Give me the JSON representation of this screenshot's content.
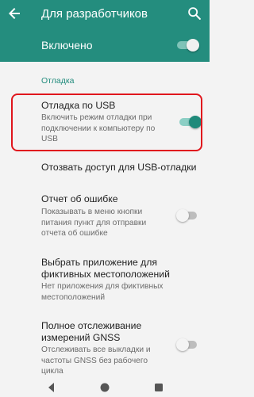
{
  "appbar": {
    "title": "Для разработчиков",
    "back_icon": "arrow-back-icon",
    "search_icon": "search-icon"
  },
  "master": {
    "label": "Включено",
    "enabled": true
  },
  "section": {
    "header": "Отладка"
  },
  "items": [
    {
      "title": "Отладка по USB",
      "summary": "Включить режим отладки при подключении к компьютеру по USB",
      "toggle": "on"
    },
    {
      "title": "Отозвать доступ для USB-отладки"
    },
    {
      "title": "Отчет об ошибке",
      "summary": "Показывать в меню кнопки питания пункт для отправки отчета об ошибке",
      "toggle": "off"
    },
    {
      "title": "Выбрать приложение для фиктивных местоположений",
      "summary": "Нет приложения для фиктивных местоположений"
    },
    {
      "title": "Полное отслеживание измерений GNSS",
      "summary": "Отслеживать все выкладки и частоты GNSS без рабочего цикла",
      "toggle": "off"
    }
  ],
  "navbar": {
    "back_icon": "nav-back-icon",
    "home_icon": "nav-home-icon",
    "recents_icon": "nav-recents-icon"
  },
  "colors": {
    "accent": "#248d7e",
    "highlight": "#e0161d"
  }
}
